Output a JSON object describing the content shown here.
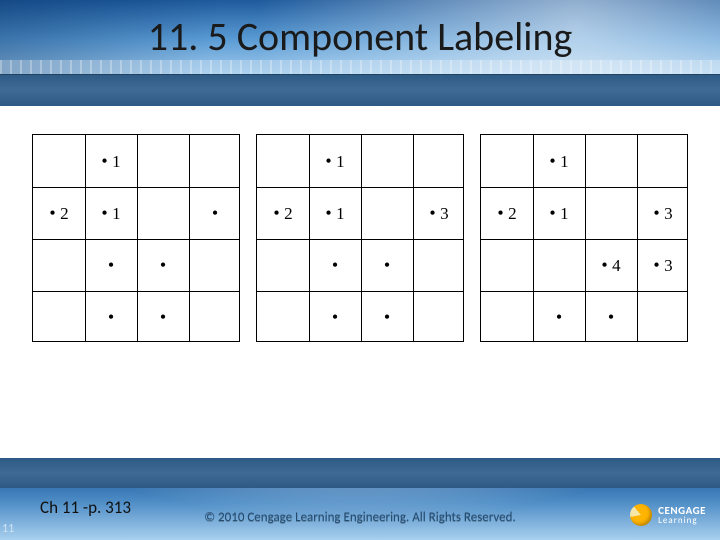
{
  "title": "11. 5 Component Labeling",
  "page_number": "11",
  "chapter_ref": "Ch 11 -p. 313",
  "copyright": "© 2010 Cengage Learning Engineering. All Rights Reserved.",
  "brand": {
    "name": "CENGAGE",
    "sub": "Learning"
  },
  "grid_size": {
    "rows": 4,
    "cols": 4
  },
  "grids": [
    {
      "cells": [
        {
          "r": 0,
          "c": 1,
          "label": "1"
        },
        {
          "r": 1,
          "c": 0,
          "label": "2"
        },
        {
          "r": 1,
          "c": 1,
          "label": "1"
        },
        {
          "r": 1,
          "c": 3,
          "label": ""
        },
        {
          "r": 2,
          "c": 1,
          "label": ""
        },
        {
          "r": 2,
          "c": 2,
          "label": ""
        },
        {
          "r": 3,
          "c": 1,
          "label": ""
        },
        {
          "r": 3,
          "c": 2,
          "label": ""
        }
      ]
    },
    {
      "cells": [
        {
          "r": 0,
          "c": 1,
          "label": "1"
        },
        {
          "r": 1,
          "c": 0,
          "label": "2"
        },
        {
          "r": 1,
          "c": 1,
          "label": "1"
        },
        {
          "r": 1,
          "c": 3,
          "label": "3"
        },
        {
          "r": 2,
          "c": 1,
          "label": ""
        },
        {
          "r": 2,
          "c": 2,
          "label": ""
        },
        {
          "r": 3,
          "c": 1,
          "label": ""
        },
        {
          "r": 3,
          "c": 2,
          "label": ""
        }
      ]
    },
    {
      "cells": [
        {
          "r": 0,
          "c": 1,
          "label": "1"
        },
        {
          "r": 1,
          "c": 0,
          "label": "2"
        },
        {
          "r": 1,
          "c": 1,
          "label": "1"
        },
        {
          "r": 1,
          "c": 3,
          "label": "3"
        },
        {
          "r": 2,
          "c": 2,
          "label": "4"
        },
        {
          "r": 2,
          "c": 3,
          "label": "3"
        },
        {
          "r": 3,
          "c": 1,
          "label": ""
        },
        {
          "r": 3,
          "c": 2,
          "label": ""
        }
      ]
    }
  ]
}
